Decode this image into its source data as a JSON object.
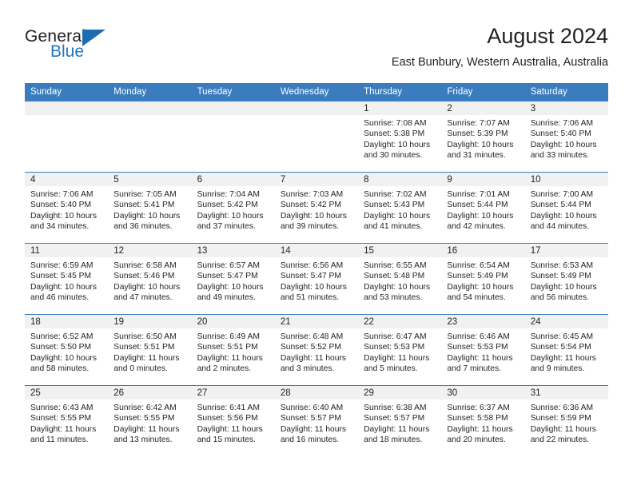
{
  "brand": {
    "name_part1": "General",
    "name_part2": "Blue",
    "triangle_icon": "blue-triangle-icon"
  },
  "header": {
    "title": "August 2024",
    "subtitle": "East Bunbury, Western Australia, Australia"
  },
  "colors": {
    "header_blue": "#3a7cbe",
    "daynum_gray": "#f1f1f1",
    "brand_blue": "#2176bd",
    "text": "#231f20"
  },
  "weekday_headers": [
    "Sunday",
    "Monday",
    "Tuesday",
    "Wednesday",
    "Thursday",
    "Friday",
    "Saturday"
  ],
  "labels": {
    "sunrise_prefix": "Sunrise:",
    "sunset_prefix": "Sunset:",
    "daylight_prefix": "Daylight:"
  },
  "weeks": [
    [
      {
        "day": "",
        "empty": true
      },
      {
        "day": "",
        "empty": true
      },
      {
        "day": "",
        "empty": true
      },
      {
        "day": "",
        "empty": true
      },
      {
        "day": "1",
        "sunrise": "Sunrise: 7:08 AM",
        "sunset": "Sunset: 5:38 PM",
        "daylight1": "Daylight: 10 hours",
        "daylight2": "and 30 minutes."
      },
      {
        "day": "2",
        "sunrise": "Sunrise: 7:07 AM",
        "sunset": "Sunset: 5:39 PM",
        "daylight1": "Daylight: 10 hours",
        "daylight2": "and 31 minutes."
      },
      {
        "day": "3",
        "sunrise": "Sunrise: 7:06 AM",
        "sunset": "Sunset: 5:40 PM",
        "daylight1": "Daylight: 10 hours",
        "daylight2": "and 33 minutes."
      }
    ],
    [
      {
        "day": "4",
        "sunrise": "Sunrise: 7:06 AM",
        "sunset": "Sunset: 5:40 PM",
        "daylight1": "Daylight: 10 hours",
        "daylight2": "and 34 minutes."
      },
      {
        "day": "5",
        "sunrise": "Sunrise: 7:05 AM",
        "sunset": "Sunset: 5:41 PM",
        "daylight1": "Daylight: 10 hours",
        "daylight2": "and 36 minutes."
      },
      {
        "day": "6",
        "sunrise": "Sunrise: 7:04 AM",
        "sunset": "Sunset: 5:42 PM",
        "daylight1": "Daylight: 10 hours",
        "daylight2": "and 37 minutes."
      },
      {
        "day": "7",
        "sunrise": "Sunrise: 7:03 AM",
        "sunset": "Sunset: 5:42 PM",
        "daylight1": "Daylight: 10 hours",
        "daylight2": "and 39 minutes."
      },
      {
        "day": "8",
        "sunrise": "Sunrise: 7:02 AM",
        "sunset": "Sunset: 5:43 PM",
        "daylight1": "Daylight: 10 hours",
        "daylight2": "and 41 minutes."
      },
      {
        "day": "9",
        "sunrise": "Sunrise: 7:01 AM",
        "sunset": "Sunset: 5:44 PM",
        "daylight1": "Daylight: 10 hours",
        "daylight2": "and 42 minutes."
      },
      {
        "day": "10",
        "sunrise": "Sunrise: 7:00 AM",
        "sunset": "Sunset: 5:44 PM",
        "daylight1": "Daylight: 10 hours",
        "daylight2": "and 44 minutes."
      }
    ],
    [
      {
        "day": "11",
        "sunrise": "Sunrise: 6:59 AM",
        "sunset": "Sunset: 5:45 PM",
        "daylight1": "Daylight: 10 hours",
        "daylight2": "and 46 minutes."
      },
      {
        "day": "12",
        "sunrise": "Sunrise: 6:58 AM",
        "sunset": "Sunset: 5:46 PM",
        "daylight1": "Daylight: 10 hours",
        "daylight2": "and 47 minutes."
      },
      {
        "day": "13",
        "sunrise": "Sunrise: 6:57 AM",
        "sunset": "Sunset: 5:47 PM",
        "daylight1": "Daylight: 10 hours",
        "daylight2": "and 49 minutes."
      },
      {
        "day": "14",
        "sunrise": "Sunrise: 6:56 AM",
        "sunset": "Sunset: 5:47 PM",
        "daylight1": "Daylight: 10 hours",
        "daylight2": "and 51 minutes."
      },
      {
        "day": "15",
        "sunrise": "Sunrise: 6:55 AM",
        "sunset": "Sunset: 5:48 PM",
        "daylight1": "Daylight: 10 hours",
        "daylight2": "and 53 minutes."
      },
      {
        "day": "16",
        "sunrise": "Sunrise: 6:54 AM",
        "sunset": "Sunset: 5:49 PM",
        "daylight1": "Daylight: 10 hours",
        "daylight2": "and 54 minutes."
      },
      {
        "day": "17",
        "sunrise": "Sunrise: 6:53 AM",
        "sunset": "Sunset: 5:49 PM",
        "daylight1": "Daylight: 10 hours",
        "daylight2": "and 56 minutes."
      }
    ],
    [
      {
        "day": "18",
        "sunrise": "Sunrise: 6:52 AM",
        "sunset": "Sunset: 5:50 PM",
        "daylight1": "Daylight: 10 hours",
        "daylight2": "and 58 minutes."
      },
      {
        "day": "19",
        "sunrise": "Sunrise: 6:50 AM",
        "sunset": "Sunset: 5:51 PM",
        "daylight1": "Daylight: 11 hours",
        "daylight2": "and 0 minutes."
      },
      {
        "day": "20",
        "sunrise": "Sunrise: 6:49 AM",
        "sunset": "Sunset: 5:51 PM",
        "daylight1": "Daylight: 11 hours",
        "daylight2": "and 2 minutes."
      },
      {
        "day": "21",
        "sunrise": "Sunrise: 6:48 AM",
        "sunset": "Sunset: 5:52 PM",
        "daylight1": "Daylight: 11 hours",
        "daylight2": "and 3 minutes."
      },
      {
        "day": "22",
        "sunrise": "Sunrise: 6:47 AM",
        "sunset": "Sunset: 5:53 PM",
        "daylight1": "Daylight: 11 hours",
        "daylight2": "and 5 minutes."
      },
      {
        "day": "23",
        "sunrise": "Sunrise: 6:46 AM",
        "sunset": "Sunset: 5:53 PM",
        "daylight1": "Daylight: 11 hours",
        "daylight2": "and 7 minutes."
      },
      {
        "day": "24",
        "sunrise": "Sunrise: 6:45 AM",
        "sunset": "Sunset: 5:54 PM",
        "daylight1": "Daylight: 11 hours",
        "daylight2": "and 9 minutes."
      }
    ],
    [
      {
        "day": "25",
        "sunrise": "Sunrise: 6:43 AM",
        "sunset": "Sunset: 5:55 PM",
        "daylight1": "Daylight: 11 hours",
        "daylight2": "and 11 minutes."
      },
      {
        "day": "26",
        "sunrise": "Sunrise: 6:42 AM",
        "sunset": "Sunset: 5:55 PM",
        "daylight1": "Daylight: 11 hours",
        "daylight2": "and 13 minutes."
      },
      {
        "day": "27",
        "sunrise": "Sunrise: 6:41 AM",
        "sunset": "Sunset: 5:56 PM",
        "daylight1": "Daylight: 11 hours",
        "daylight2": "and 15 minutes."
      },
      {
        "day": "28",
        "sunrise": "Sunrise: 6:40 AM",
        "sunset": "Sunset: 5:57 PM",
        "daylight1": "Daylight: 11 hours",
        "daylight2": "and 16 minutes."
      },
      {
        "day": "29",
        "sunrise": "Sunrise: 6:38 AM",
        "sunset": "Sunset: 5:57 PM",
        "daylight1": "Daylight: 11 hours",
        "daylight2": "and 18 minutes."
      },
      {
        "day": "30",
        "sunrise": "Sunrise: 6:37 AM",
        "sunset": "Sunset: 5:58 PM",
        "daylight1": "Daylight: 11 hours",
        "daylight2": "and 20 minutes."
      },
      {
        "day": "31",
        "sunrise": "Sunrise: 6:36 AM",
        "sunset": "Sunset: 5:59 PM",
        "daylight1": "Daylight: 11 hours",
        "daylight2": "and 22 minutes."
      }
    ]
  ]
}
